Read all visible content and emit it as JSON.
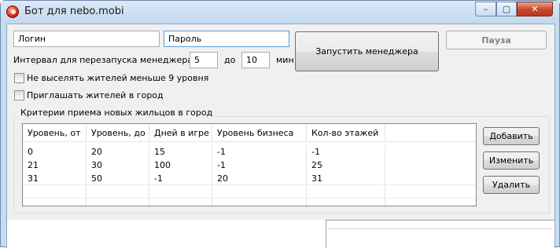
{
  "window": {
    "title": "Бот для nebo.mobi",
    "controls": {
      "minimize": "–",
      "maximize": "▢",
      "close": "✕"
    }
  },
  "login": {
    "value": "Логин"
  },
  "password": {
    "value": "Пароль"
  },
  "interval": {
    "label": "Интервал для перезапуска менеджера: от",
    "from_value": "5",
    "to_label": "до",
    "to_value": "10",
    "unit": "мин"
  },
  "buttons": {
    "start_manager": "Запустить менеджера",
    "pause": "Пауза",
    "add": "Добавить",
    "edit": "Изменить",
    "delete": "Удалить"
  },
  "options": {
    "no_evict_label": "Не выселять жителей меньше 9 уровня",
    "invite_label": "Приглашать жителей в город"
  },
  "criteria": {
    "title": "Критерии приема новых жильцов в город",
    "columns": [
      "Уровень, от",
      "Уровень, до",
      "Дней в игре",
      "Уровень бизнеса",
      "Кол-во этажей"
    ],
    "rows": [
      [
        "0",
        "20",
        "15",
        "-1",
        "-1"
      ],
      [
        "21",
        "30",
        "100",
        "-1",
        "25"
      ],
      [
        "31",
        "50",
        "-1",
        "20",
        "31"
      ]
    ]
  }
}
